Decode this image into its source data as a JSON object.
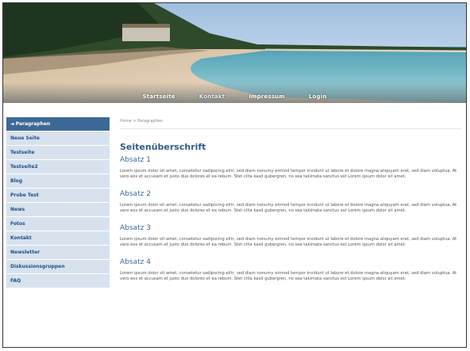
{
  "header": {
    "nav": [
      "Startseite",
      "Kontakt",
      "Impressum",
      "Login"
    ]
  },
  "sidebar": {
    "items": [
      {
        "label": "◄ Paragraphen",
        "active": true
      },
      {
        "label": "Neue Seite",
        "active": false
      },
      {
        "label": "Testseite",
        "active": false
      },
      {
        "label": "Testseite2",
        "active": false
      },
      {
        "label": "Blog",
        "active": false
      },
      {
        "label": "Probe Test",
        "active": false
      },
      {
        "label": "News",
        "active": false
      },
      {
        "label": "Fotos",
        "active": false
      },
      {
        "label": "Kontakt",
        "active": false
      },
      {
        "label": "Newsletter",
        "active": false
      },
      {
        "label": "Diskussionsgruppen",
        "active": false
      },
      {
        "label": "FAQ",
        "active": false
      }
    ]
  },
  "main": {
    "breadcrumb": "Home > Paragraphen",
    "title": "Seitenüberschrift",
    "sections": [
      {
        "heading": "Absatz 1",
        "text": "Lorem ipsum dolor sit amet, consetetur sadipscing elitr, sed diam nonumy eirmod tempor invidunt ut labore et dolore magna aliquyam erat, sed diam voluptua. At vero eos et accusam et justo duo dolores et ea rebum. Stet clita kasd gubergren, no sea takimata sanctus est Lorem ipsum dolor sit amet."
      },
      {
        "heading": "Absatz 2",
        "text": "Lorem ipsum dolor sit amet, consetetur sadipscing elitr, sed diam nonumy eirmod tempor invidunt ut labore et dolore magna aliquyam erat, sed diam voluptua. At vero eos et accusam et justo duo dolores et ea rebum. Stet clita kasd gubergren, no sea takimata sanctus est Lorem ipsum dolor sit amet."
      },
      {
        "heading": "Absatz 3",
        "text": "Lorem ipsum dolor sit amet, consetetur sadipscing elitr, sed diam nonumy eirmod tempor invidunt ut labore et dolore magna aliquyam erat, sed diam voluptua. At vero eos et accusam et justo duo dolores et ea rebum. Stet clita kasd gubergren, no sea takimata sanctus est Lorem ipsum dolor sit amet."
      },
      {
        "heading": "Absatz 4",
        "text": "Lorem ipsum dolor sit amet, consetetur sadipscing elitr, sed diam nonumy eirmod tempor invidunt ut labore et dolore magna aliquyam erat, sed diam voluptua. At vero eos et accusam et justo duo dolores et ea rebum. Stet clita kasd gubergren, no sea takimata sanctus est Lorem ipsum dolor sit amet."
      }
    ]
  },
  "colors": {
    "accent": "#3d6896",
    "sidebar_bg": "#d7e2ee",
    "heading": "#2e5d8c"
  }
}
